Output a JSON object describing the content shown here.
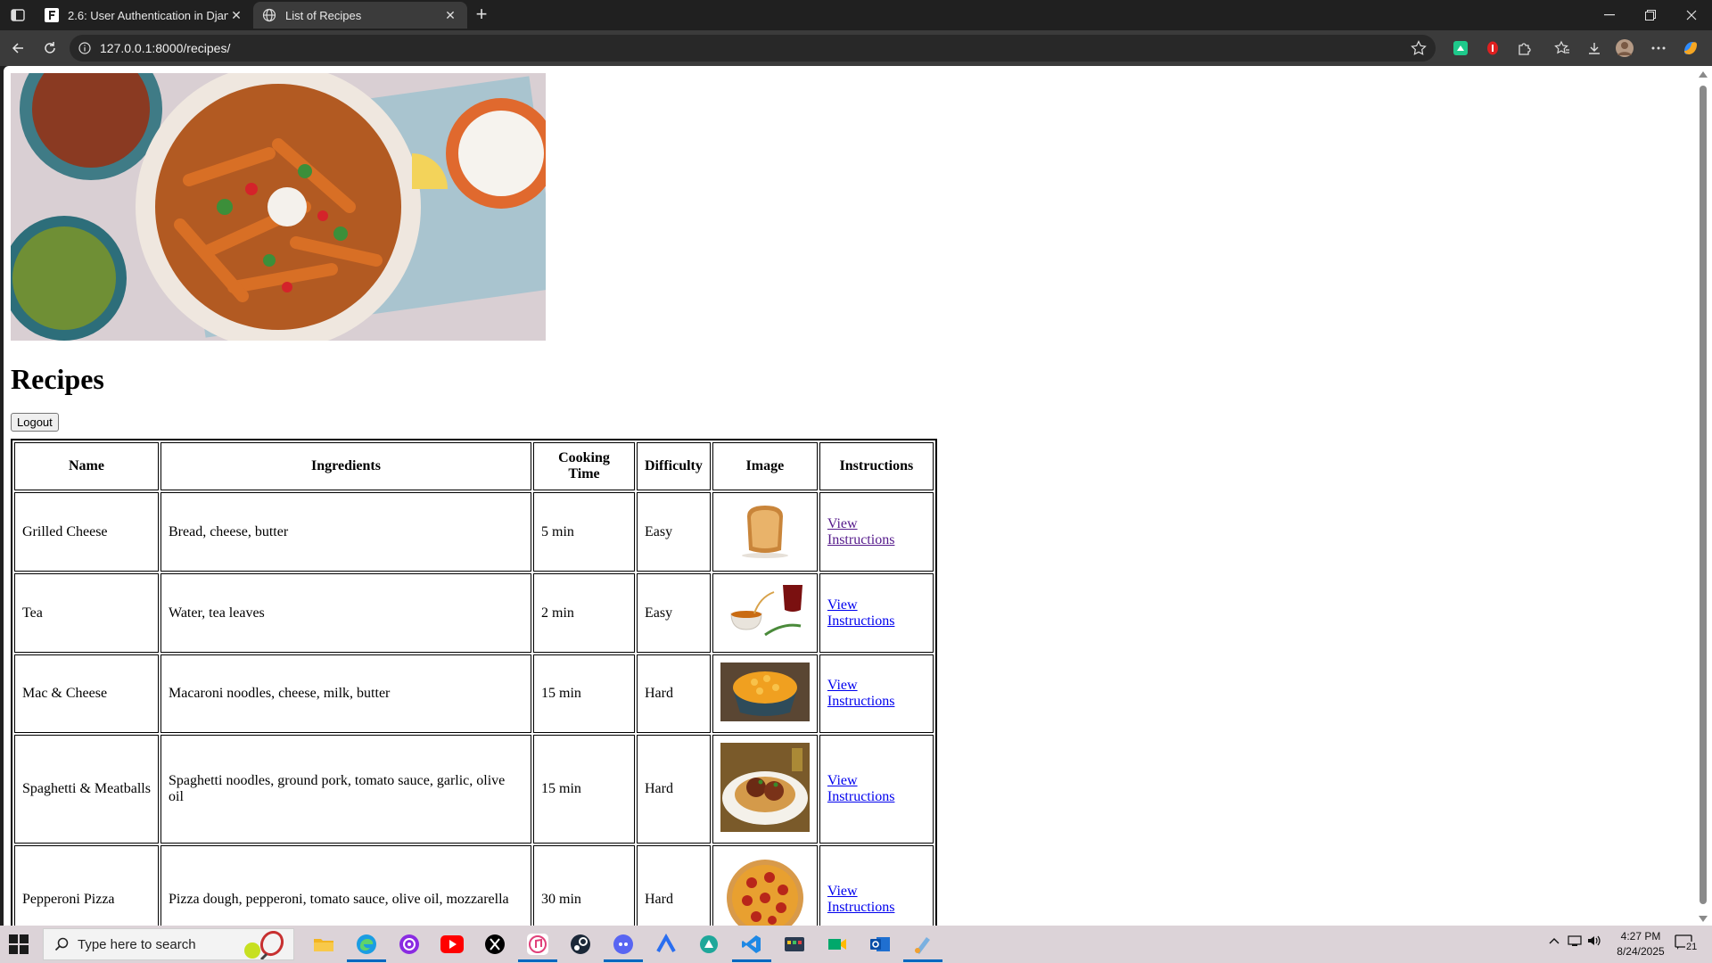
{
  "browser": {
    "tabs": [
      {
        "title": "2.6: User Authentication in Django",
        "active": false
      },
      {
        "title": "List of Recipes",
        "active": true
      }
    ],
    "url": "127.0.0.1:8000/recipes/"
  },
  "page": {
    "title": "Recipes",
    "logout_label": "Logout",
    "table": {
      "headers": [
        "Name",
        "Ingredients",
        "Cooking Time",
        "Difficulty",
        "Image",
        "Instructions"
      ],
      "rows": [
        {
          "name": "Grilled Cheese",
          "ingredients": "Bread, cheese, butter",
          "time": "5 min",
          "difficulty": "Easy",
          "image": "grilled-cheese-image",
          "link": "View Instructions"
        },
        {
          "name": "Tea",
          "ingredients": "Water, tea leaves",
          "time": "2 min",
          "difficulty": "Easy",
          "image": "tea-image",
          "link": "View Instructions"
        },
        {
          "name": "Mac & Cheese",
          "ingredients": "Macaroni noodles, cheese, milk, butter",
          "time": "15 min",
          "difficulty": "Hard",
          "image": "mac-and-cheese-image",
          "link": "View Instructions"
        },
        {
          "name": "Spaghetti & Meatballs",
          "ingredients": "Spaghetti noodles, ground pork, tomato sauce, garlic, olive oil",
          "time": "15 min",
          "difficulty": "Hard",
          "image": "spaghetti-image",
          "link": "View Instructions"
        },
        {
          "name": "Pepperoni Pizza",
          "ingredients": "Pizza dough, pepperoni, tomato sauce, olive oil, mozzarella",
          "time": "30 min",
          "difficulty": "Hard",
          "image": "pizza-image",
          "link": "View Instructions"
        }
      ]
    }
  },
  "taskbar": {
    "search_placeholder": "Type here to search",
    "time": "4:27 PM",
    "date": "8/24/2025",
    "notifications": "21"
  },
  "colors": {
    "link": "#0000ee",
    "visited_link": "#551a8b",
    "taskbar_bg": "#dcd3d8",
    "browser_chrome": "#202020",
    "toolbar": "#3b3b3b"
  }
}
